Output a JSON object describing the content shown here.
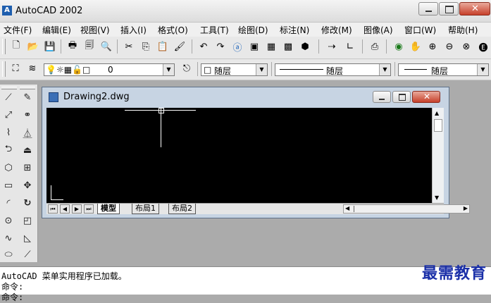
{
  "app": {
    "title": "AutoCAD 2002",
    "icon_label": "A"
  },
  "menu": [
    "文件(F)",
    "编辑(E)",
    "视图(V)",
    "插入(I)",
    "格式(O)",
    "工具(T)",
    "绘图(D)",
    "标注(N)",
    "修改(M)",
    "图像(A)",
    "窗口(W)",
    "帮助(H)"
  ],
  "properties": {
    "layer_value": "0",
    "color_value": "随层",
    "linetype_value": "随层",
    "lineweight_value": "随层"
  },
  "drawing": {
    "title": "Drawing2.dwg",
    "tabs": [
      "模型",
      "布局1",
      "布局2"
    ],
    "active_tab": 0
  },
  "command": {
    "line1": "AutoCAD 菜单实用程序已加载。",
    "line2": "命令:",
    "line3": "命令:"
  },
  "watermark": "最需教育",
  "colors": {
    "canvas": "#000000",
    "accent": "#1a2fa8",
    "close": "#c7402a"
  }
}
